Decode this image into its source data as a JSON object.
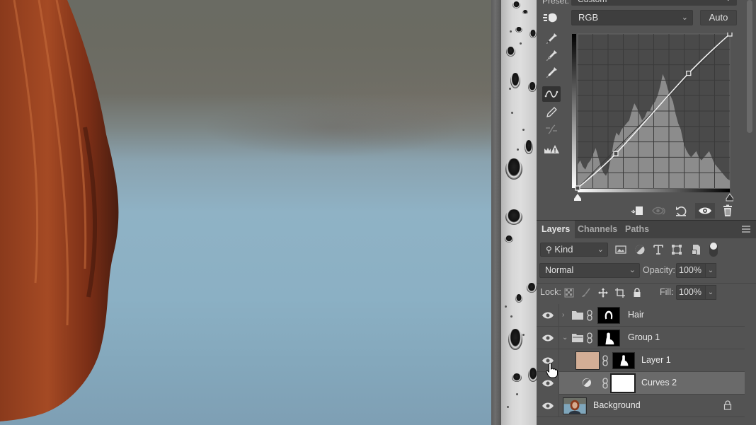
{
  "properties": {
    "preset_label": "Preset:",
    "preset_value": "Custom",
    "channel_value": "RGB",
    "auto_label": "Auto",
    "curve_tools": [
      {
        "name": "sample-black-point-icon"
      },
      {
        "name": "sample-gray-point-icon"
      },
      {
        "name": "sample-white-point-icon"
      },
      {
        "name": "edit-points-curve-icon",
        "active": true
      },
      {
        "name": "draw-pencil-icon"
      },
      {
        "name": "smooth-curve-icon"
      },
      {
        "name": "clipping-warning-icon"
      }
    ],
    "curve": {
      "input_range": [
        0,
        255
      ],
      "output_range": [
        0,
        255
      ],
      "points": [
        [
          0,
          0
        ],
        [
          64,
          57
        ],
        [
          186,
          190
        ],
        [
          255,
          255
        ]
      ],
      "black_slider": 0,
      "white_slider": 255
    },
    "footer_buttons": [
      {
        "name": "clip-to-layer-button"
      },
      {
        "name": "view-previous-state-button"
      },
      {
        "name": "reset-adjustment-button"
      },
      {
        "name": "toggle-visibility-button",
        "active": true
      },
      {
        "name": "delete-adjustment-button"
      }
    ]
  },
  "layers_panel": {
    "tabs": [
      {
        "label": "Layers",
        "active": true
      },
      {
        "label": "Channels",
        "active": false
      },
      {
        "label": "Paths",
        "active": false
      }
    ],
    "filter_kind": "Kind",
    "blend_mode": "Normal",
    "opacity_label": "Opacity:",
    "opacity_value": "100%",
    "lock_label": "Lock:",
    "fill_label": "Fill:",
    "fill_value": "100%",
    "layers": [
      {
        "name": "Hair",
        "type": "group",
        "expanded": false,
        "visible": true,
        "mask": "hair-mask"
      },
      {
        "name": "Group 1",
        "type": "group",
        "expanded": true,
        "visible": true,
        "mask": "figure-mask"
      },
      {
        "name": "Layer 1",
        "type": "fill",
        "color": "#d3ae96",
        "visible": true,
        "mask": "small-figure-mask"
      },
      {
        "name": "Curves 2",
        "type": "adjustment",
        "visible": true,
        "selected": true,
        "mask": "white-mask"
      },
      {
        "name": "Background",
        "type": "image",
        "visible": true,
        "locked": true
      }
    ]
  }
}
